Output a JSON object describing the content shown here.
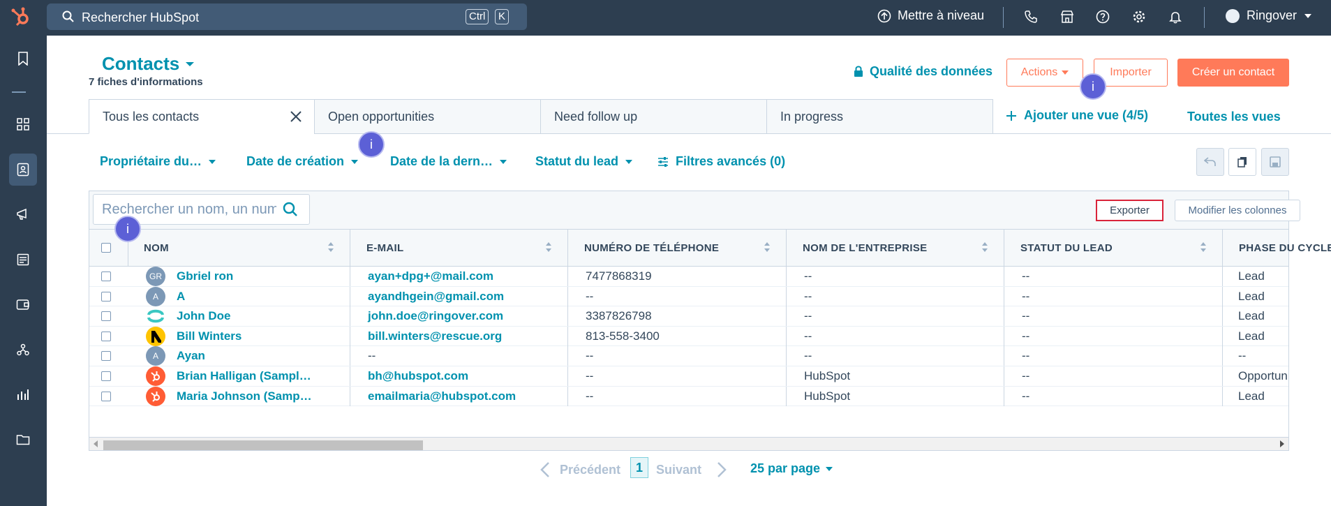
{
  "topbar": {
    "search_placeholder": "Rechercher HubSpot",
    "kbd_ctrl": "Ctrl",
    "kbd_k": "K",
    "upgrade_label": "Mettre à niveau",
    "account_name": "Ringover",
    "icons": [
      "phone-icon",
      "marketplace-icon",
      "help-icon",
      "settings-icon",
      "notifications-icon"
    ]
  },
  "rail": {
    "icons": [
      "bookmark-icon",
      "dashboard-icon",
      "contacts-icon",
      "marketing-icon",
      "content-icon",
      "commerce-icon",
      "automation-icon",
      "reporting-icon",
      "library-icon"
    ],
    "active": "contacts-icon"
  },
  "header": {
    "title": "Contacts",
    "record_count": "7 fiches d'informations",
    "data_quality": "Qualité des données",
    "actions": "Actions",
    "import": "Importer",
    "create": "Créer un contact"
  },
  "tabs": [
    {
      "label": "Tous les contacts",
      "active": true
    },
    {
      "label": "Open opportunities",
      "active": false
    },
    {
      "label": "Need follow up",
      "active": false
    },
    {
      "label": "In progress",
      "active": false
    }
  ],
  "views": {
    "add_view": "Ajouter une vue (4/5)",
    "all_views": "Toutes les vues"
  },
  "filters": {
    "owner": "Propriétaire du…",
    "created": "Date de création",
    "last": "Date de la dern…",
    "lead_status": "Statut du lead",
    "advanced": "Filtres avancés (0)"
  },
  "table": {
    "search_placeholder": "Rechercher un nom, un numéro de téléphone",
    "export": "Exporter",
    "edit_columns": "Modifier les colonnes",
    "columns": [
      "NOM",
      "E-MAIL",
      "NUMÉRO DE TÉLÉPHONE",
      "NOM DE L'ENTREPRISE",
      "STATUT DU LEAD",
      "PHASE DU CYCLE DE VIE"
    ],
    "rows": [
      {
        "avatar": "GR",
        "name": "Gbriel ron",
        "email": "ayan+dpg+@mail.com",
        "phone": "7477868319",
        "company": "--",
        "status": "--",
        "phase": "Lead"
      },
      {
        "avatar": "A",
        "name": "A",
        "email": "ayandhgein@gmail.com",
        "phone": "--",
        "company": "--",
        "status": "--",
        "phase": "Lead"
      },
      {
        "avatar": "",
        "name": "John Doe",
        "email": "john.doe@ringover.com",
        "phone": "3387826798",
        "company": "--",
        "status": "--",
        "phase": "Lead"
      },
      {
        "avatar": "",
        "name": "Bill Winters",
        "email": "bill.winters@rescue.org",
        "phone": "813-558-3400",
        "company": "--",
        "status": "--",
        "phase": "Lead"
      },
      {
        "avatar": "A",
        "name": "Ayan",
        "email": "--",
        "phone": "--",
        "company": "--",
        "status": "--",
        "phase": "--"
      },
      {
        "avatar": "",
        "name": "Brian Halligan (Sampl…",
        "email": "bh@hubspot.com",
        "phone": "--",
        "company": "HubSpot",
        "status": "--",
        "phase": "Opportunity"
      },
      {
        "avatar": "",
        "name": "Maria Johnson (Samp…",
        "email": "emailmaria@hubspot.com",
        "phone": "--",
        "company": "HubSpot",
        "status": "--",
        "phase": "Lead"
      }
    ]
  },
  "pagination": {
    "prev": "Précédent",
    "current": "1",
    "next": "Suivant",
    "per_page": "25 par page"
  },
  "badges": {
    "label": "i"
  },
  "colors": {
    "accent": "#0091ae",
    "brand": "#ff7a59",
    "nav": "#2d3e50",
    "badge": "#5c60d6"
  }
}
